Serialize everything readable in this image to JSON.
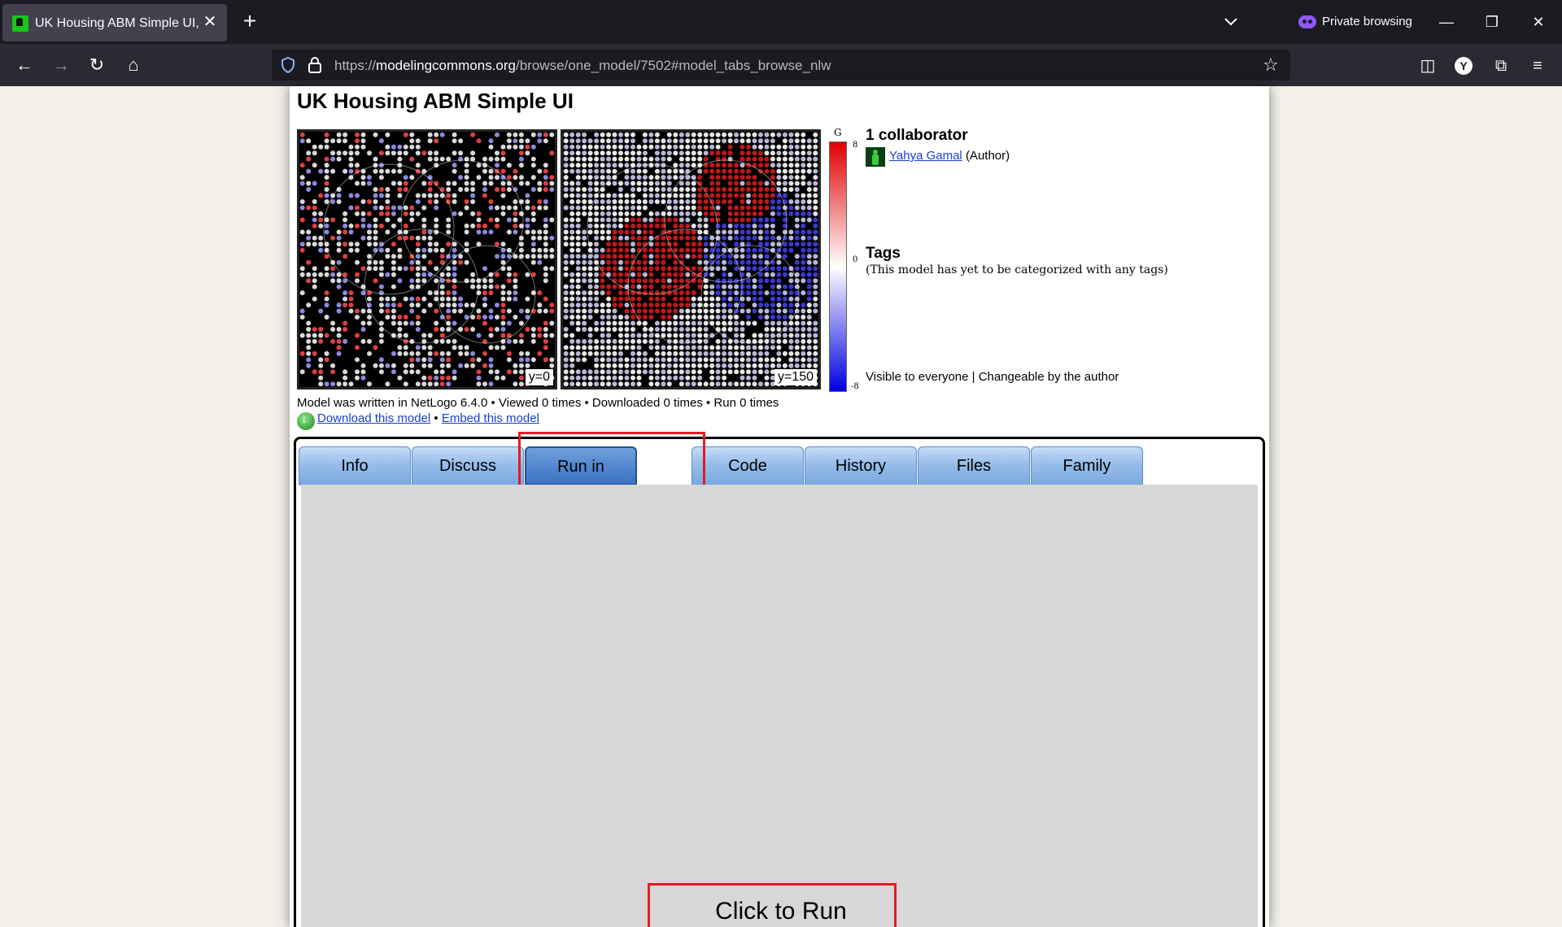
{
  "browser": {
    "tab_title": "UK Housing ABM Simple UI, by Yahya Gamal",
    "tab_close": "✕",
    "new_tab": "+",
    "private_label": "Private browsing",
    "url_prefix": "https://",
    "url_domain": "modelingcommons.org",
    "url_path": "/browse/one_model/7502#model_tabs_browse_nlw",
    "nav": {
      "back": "←",
      "forward": "→",
      "reload": "↻",
      "home": "⌂",
      "star": "☆"
    },
    "toolbar": {
      "pocket": "◫",
      "profile": "Y",
      "extensions": "⧉",
      "menu": "≡"
    },
    "window": {
      "minimize": "—",
      "restore": "❐",
      "close": "✕"
    }
  },
  "page": {
    "title": "UK Housing ABM Simple UI",
    "previews": [
      {
        "label": "y=0"
      },
      {
        "label": "y=150"
      }
    ],
    "scale": {
      "top_label": "G",
      "max": "8",
      "mid": "0",
      "min": "-8",
      "colors": [
        "#e00000",
        "#ffffff",
        "#0000e0"
      ]
    },
    "collaborators": {
      "heading": "1 collaborator",
      "name": "Yahya Gamal",
      "role": "(Author)"
    },
    "tags": {
      "heading": "Tags",
      "note": "(This model has yet to be categorized with any tags)"
    },
    "visibility": "Visible to everyone | Changeable by the author",
    "meta": "Model was written in NetLogo 6.4.0 • Viewed 0 times • Downloaded 0 times • Run 0 times",
    "links": {
      "download": "Download this model",
      "separator": " • ",
      "embed": "Embed this model"
    },
    "tabs": [
      {
        "label": "Info"
      },
      {
        "label": "Discuss"
      },
      {
        "label": "Run in NetLogo Web",
        "active": true
      },
      {
        "label": "Code"
      },
      {
        "label": "History"
      },
      {
        "label": "Files"
      },
      {
        "label": "Family"
      }
    ],
    "run_button": "Click to Run Model"
  }
}
